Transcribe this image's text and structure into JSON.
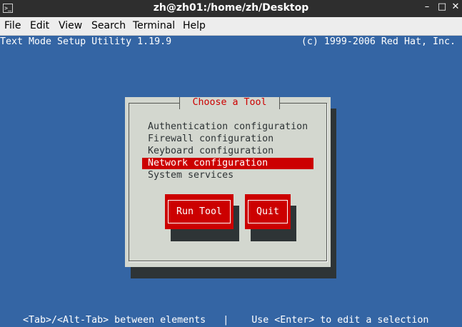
{
  "window": {
    "title": "zh@zh01:/home/zh/Desktop",
    "minimize": "–",
    "maximize": "□",
    "close": "✕"
  },
  "menubar": {
    "items": [
      "File",
      "Edit",
      "View",
      "Search",
      "Terminal",
      "Help"
    ]
  },
  "terminal": {
    "header_left": "Text Mode Setup Utility 1.19.9",
    "header_right": "(c) 1999-2006 Red Hat, Inc.",
    "footer": "<Tab>/<Alt-Tab> between elements   |    Use <Enter> to edit a selection"
  },
  "dialog": {
    "title": "Choose a Tool",
    "items": [
      "Authentication configuration",
      "Firewall configuration",
      "Keyboard configuration",
      "Network configuration",
      "System services"
    ],
    "selected_index": 3,
    "run_label": "Run Tool",
    "quit_label": "Quit"
  },
  "colors": {
    "background": "#3465a4",
    "selected": "#cc0000",
    "dialog": "#d3d7cf"
  },
  "icons": {
    "app_icon": "terminal-icon"
  }
}
